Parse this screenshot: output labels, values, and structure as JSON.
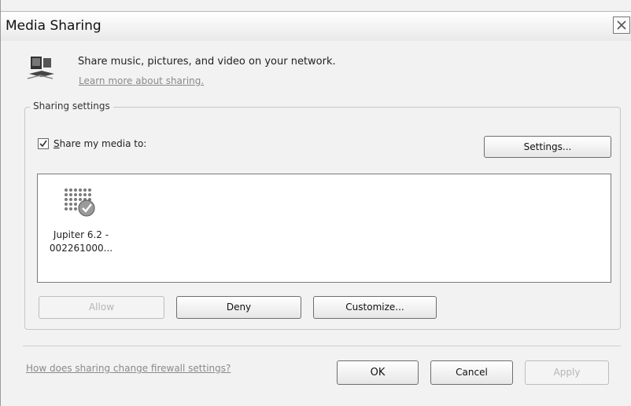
{
  "window": {
    "title": "Media Sharing",
    "close_icon": "close-icon"
  },
  "header": {
    "icon": "media-network-icon",
    "description": "Share music, pictures, and video on your network.",
    "learn_link": "Learn more about sharing."
  },
  "sharing_settings": {
    "legend": "Sharing settings",
    "share_checkbox": {
      "checked": true,
      "label_prefix": "",
      "label_accel": "S",
      "label_rest": "hare my media to:"
    },
    "settings_button": "Settings...",
    "devices": [
      {
        "icon": "allowed-device-icon",
        "name_line1": "Jupiter 6.2 -",
        "name_line2": "002261000..."
      }
    ],
    "allow_button": "Allow",
    "deny_button": "Deny",
    "customize_button": "Customize..."
  },
  "footer": {
    "firewall_link": "How does sharing change firewall settings?",
    "ok_button": "OK",
    "cancel_button": "Cancel",
    "apply_button": "Apply"
  }
}
